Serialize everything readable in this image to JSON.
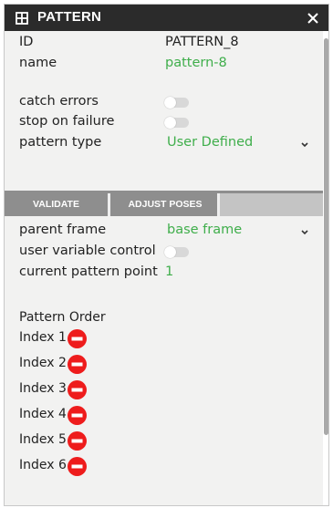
{
  "titlebar": {
    "title": "PATTERN",
    "icon": "grid-icon",
    "close_icon": "close-icon"
  },
  "fields": {
    "id_label": "ID",
    "id_value": "PATTERN_8",
    "name_label": "name",
    "name_value": "pattern-8",
    "catch_errors_label": "catch errors",
    "catch_errors_on": false,
    "stop_on_failure_label": "stop on failure",
    "stop_on_failure_on": false,
    "pattern_type_label": "pattern type",
    "pattern_type_value": "User Defined"
  },
  "buttons": {
    "validate": "VALIDATE",
    "adjust_poses": "ADJUST POSES"
  },
  "fields2": {
    "parent_frame_label": "parent frame",
    "parent_frame_value": "base frame",
    "user_variable_control_label": "user variable control",
    "user_variable_control_on": false,
    "current_pattern_point_label": "current pattern point",
    "current_pattern_point_value": "1"
  },
  "pattern_order": {
    "heading": "Pattern Order",
    "items": [
      "Index 1",
      "Index 2",
      "Index 3",
      "Index 4",
      "Index 5",
      "Index 6"
    ]
  },
  "colors": {
    "accent_green": "#3fae4b",
    "remove_red": "#ee1c1c",
    "titlebar": "#2b2b2b"
  }
}
